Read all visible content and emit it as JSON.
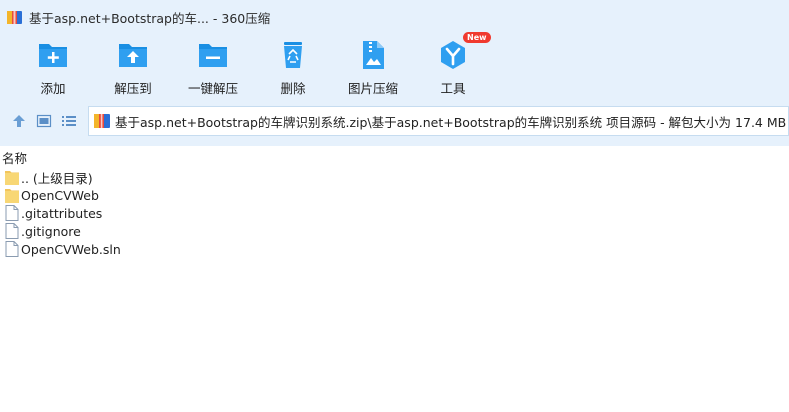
{
  "window": {
    "title": "基于asp.net+Bootstrap的车... - 360压缩"
  },
  "toolbar": {
    "items": [
      {
        "label": "添加",
        "icon": "add-folder-icon"
      },
      {
        "label": "解压到",
        "icon": "extract-to-icon"
      },
      {
        "label": "一键解压",
        "icon": "one-click-extract-icon"
      },
      {
        "label": "删除",
        "icon": "recycle-bin-icon"
      },
      {
        "label": "图片压缩",
        "icon": "image-compress-icon"
      },
      {
        "label": "工具",
        "icon": "tools-icon",
        "badge": "New"
      }
    ]
  },
  "pathbar": {
    "path": "基于asp.net+Bootstrap的车牌识别系统.zip\\基于asp.net+Bootstrap的车牌识别系统 项目源码 - 解包大小为 17.4 MB"
  },
  "filelist": {
    "column_name": "名称",
    "rows": [
      {
        "name": ".. (上级目录)",
        "type": "folder"
      },
      {
        "name": "OpenCVWeb",
        "type": "folder"
      },
      {
        "name": ".gitattributes",
        "type": "file"
      },
      {
        "name": ".gitignore",
        "type": "file"
      },
      {
        "name": "OpenCVWeb.sln",
        "type": "file"
      }
    ]
  },
  "colors": {
    "accent": "#1a8fe3",
    "background_top": "#e6f1fc",
    "badge_red": "#f03a2f"
  }
}
